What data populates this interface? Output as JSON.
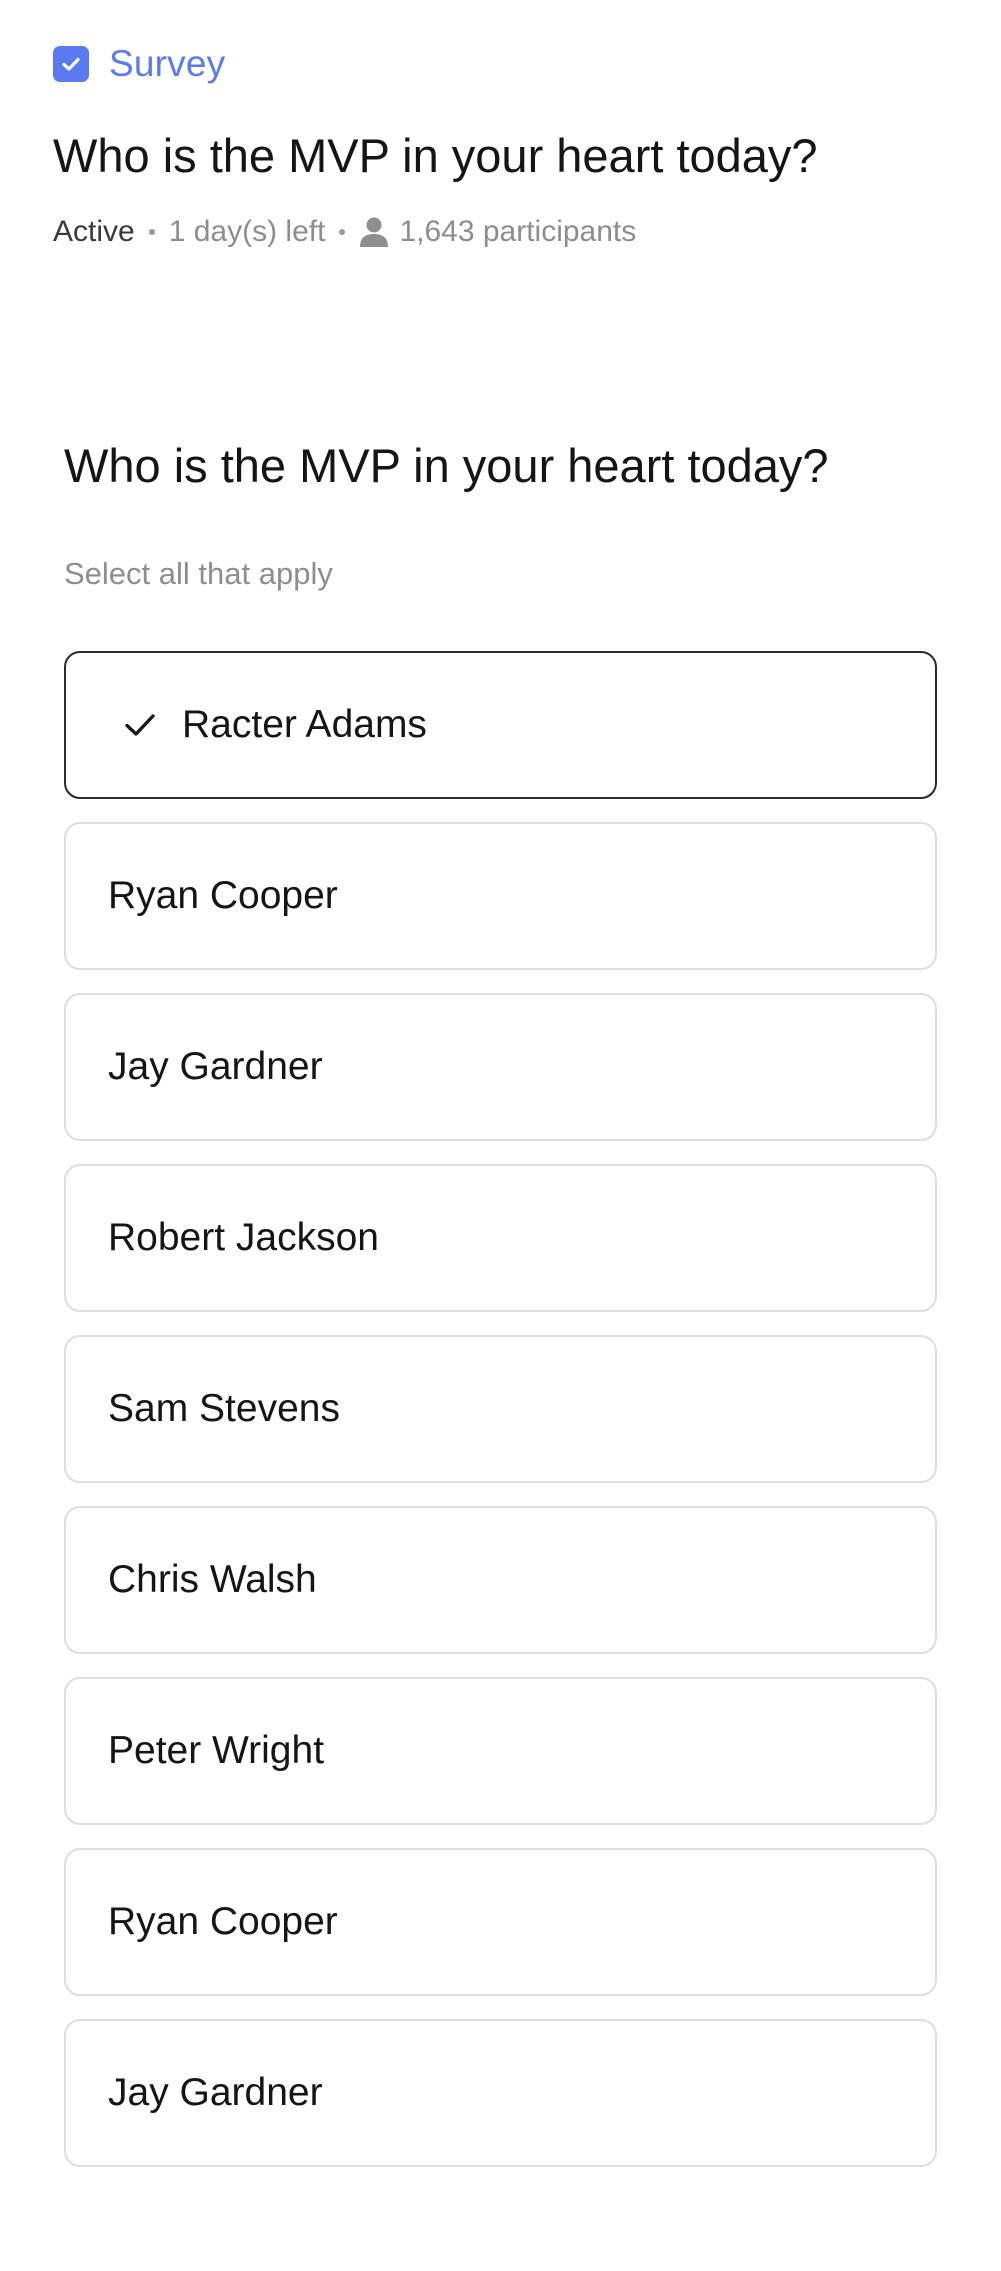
{
  "header": {
    "brand_label": "Survey",
    "title": "Who is the MVP in your heart today?",
    "status": "Active",
    "time_left": "1 day(s) left",
    "participants": "1,643 participants"
  },
  "survey": {
    "question": "Who is the MVP in your heart today?",
    "hint": "Select all that apply",
    "options": [
      {
        "label": "Racter Adams",
        "selected": true
      },
      {
        "label": "Ryan Cooper",
        "selected": false
      },
      {
        "label": "Jay Gardner",
        "selected": false
      },
      {
        "label": "Robert Jackson",
        "selected": false
      },
      {
        "label": "Sam Stevens",
        "selected": false
      },
      {
        "label": "Chris Walsh",
        "selected": false
      },
      {
        "label": "Peter Wright",
        "selected": false
      },
      {
        "label": "Ryan Cooper",
        "selected": false
      },
      {
        "label": "Jay Gardner",
        "selected": false
      }
    ]
  },
  "icons": {
    "brand": "checkbox-checked-icon",
    "participants": "person-icon",
    "selected_option": "checkmark-icon"
  },
  "colors": {
    "accent": "#5a7bef",
    "selected_border": "#2a2a2a",
    "option_border": "#dedede"
  }
}
